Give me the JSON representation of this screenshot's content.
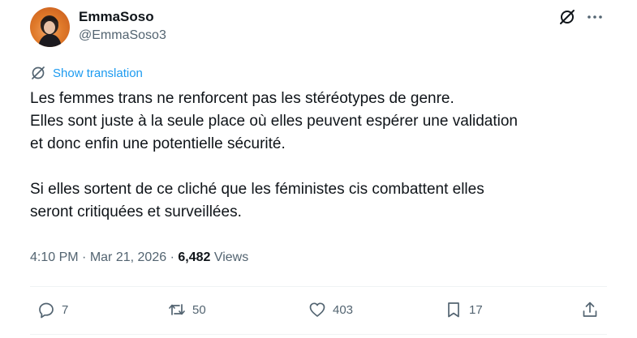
{
  "author": {
    "display_name": "EmmaSoso",
    "handle": "@EmmaSoso3",
    "avatar_color": "#e07a2a"
  },
  "header_icons": [
    "grok-icon",
    "more-icon"
  ],
  "translation": {
    "label": "Show translation",
    "icon": "globe-icon"
  },
  "tweet": {
    "line1": "Les femmes trans ne renforcent pas les stéréotypes de genre.",
    "line2": "Elles sont juste à la seule place où elles peuvent espérer une validation",
    "line3": "et donc enfin une potentielle sécurité.",
    "line4": "Si elles sortent de ce cliché que les féministes cis combattent elles",
    "line5": "seront critiquées et surveillées."
  },
  "meta": {
    "time": "4:10 PM",
    "separator": "·",
    "date": "Mar 21, 2026",
    "views_count": "6,482",
    "views_label": "Views"
  },
  "actions": {
    "reply": {
      "icon": "reply-icon",
      "count": "7"
    },
    "repost": {
      "icon": "repost-icon",
      "count": "50"
    },
    "like": {
      "icon": "heart-icon",
      "count": "403"
    },
    "bookmark": {
      "icon": "bookmark-icon",
      "count": "17"
    },
    "share": {
      "icon": "share-icon"
    }
  },
  "colors": {
    "text": "#0f1419",
    "secondary": "#536471",
    "link": "#1d9bf0",
    "divider": "#eff3f4"
  }
}
